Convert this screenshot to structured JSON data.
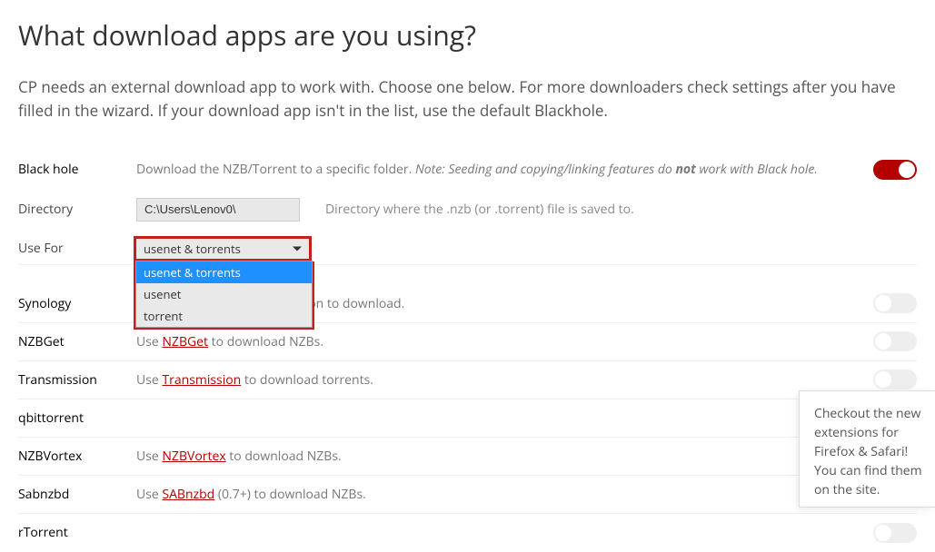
{
  "page": {
    "title": "What download apps are you using?",
    "subtitle": "CP needs an external download app to work with. Choose one below. For more downloaders check settings after you have filled in the wizard. If your download app isn't in the list, use the default Blackhole."
  },
  "blackhole": {
    "label": "Black hole",
    "desc_prefix": "Download the NZB/Torrent to a specific folder. ",
    "note_prefix": "Note: Seeding and copying/linking features do ",
    "note_bold": "not",
    "note_suffix": " work with Black hole."
  },
  "directory": {
    "label": "Directory",
    "value": "C:\\Users\\Lenov0\\",
    "hint": "Directory where the .nzb (or .torrent) file is saved to."
  },
  "usefor": {
    "label": "Use For",
    "selected": "usenet & torrents",
    "options": {
      "o0": "usenet & torrents",
      "o1": "usenet",
      "o2": "torrent"
    }
  },
  "apps": {
    "synology": {
      "label": "Synology",
      "desc_full": "Use Synology Download Station to download."
    },
    "nzbget": {
      "label": "NZBGet",
      "pre": "Use ",
      "link": "NZBGet",
      "post": " to download NZBs."
    },
    "transmission": {
      "label": "Transmission",
      "pre": "Use ",
      "link": "Transmission",
      "post": " to download torrents."
    },
    "qbittorrent": {
      "label": "qbittorrent"
    },
    "nzbvortex": {
      "label": "NZBVortex",
      "pre": "Use ",
      "link": "NZBVortex",
      "post": " to download NZBs."
    },
    "sabnzbd": {
      "label": "Sabnzbd",
      "pre": "Use ",
      "link": "SABnzbd",
      "post": " (0.7+) to download NZBs."
    },
    "rtorrent": {
      "label": "rTorrent"
    }
  },
  "popup": {
    "text": "Checkout the new extensions for Firefox & Safari! You can find them on the site."
  }
}
